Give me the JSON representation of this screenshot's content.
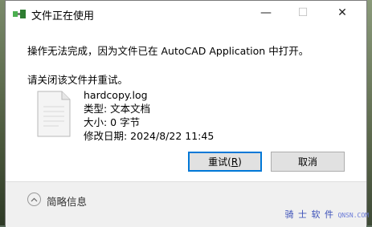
{
  "window": {
    "title": "文件正在使用",
    "minimize_glyph": "—",
    "maximize_glyph": "☐",
    "close_glyph": "✕"
  },
  "message": {
    "main": "操作无法完成，因为文件已在 AutoCAD Application 中打开。",
    "instruction": "请关闭该文件并重试。"
  },
  "file": {
    "icon": "document-icon",
    "name": "hardcopy.log",
    "type": "类型: 文本文档",
    "size": "大小: 0 字节",
    "modified": "修改日期: 2024/8/22 11:45"
  },
  "buttons": {
    "retry_prefix": "重试(",
    "retry_key": "R",
    "retry_suffix": ")",
    "cancel": "取消"
  },
  "footer": {
    "brief_label": "简略信息",
    "icon": "chevron-up-icon"
  },
  "watermark": {
    "text": "骑 士 软 件",
    "sub": "QNSN.COM"
  },
  "colors": {
    "accent": "#0078d7",
    "button_bg": "#e1e1e1",
    "footer_bg": "#f0f0f0"
  }
}
